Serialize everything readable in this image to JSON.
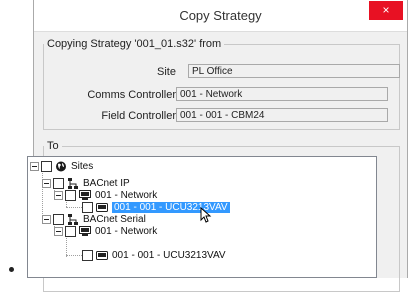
{
  "dialog": {
    "title": "Copy Strategy",
    "close_glyph": "×"
  },
  "copying": {
    "legend": "Copying Strategy '001_01.s32' from",
    "site_label": "Site",
    "site_value": "PL Office",
    "comms_label": "Comms Controller",
    "comms_value": "001 - Network",
    "field_label": "Field Controller",
    "field_value": "001 - 001 - CBM24"
  },
  "to": {
    "legend": "To",
    "tree": [
      {
        "label": "Sites",
        "icon": "globe-icon"
      },
      {
        "label": "BACnet IP",
        "icon": "network-icon"
      },
      {
        "label": "001 - Network",
        "icon": "controller-icon"
      },
      {
        "label": "001 - 001 - UCU3213VAV",
        "icon": "device-icon",
        "selected": true
      },
      {
        "label": "BACnet Serial",
        "icon": "network-icon"
      },
      {
        "label": "001 - Network",
        "icon": "controller-icon"
      },
      {
        "label": "001 - 001 - UCU3213VAV",
        "icon": "device-icon"
      }
    ]
  }
}
